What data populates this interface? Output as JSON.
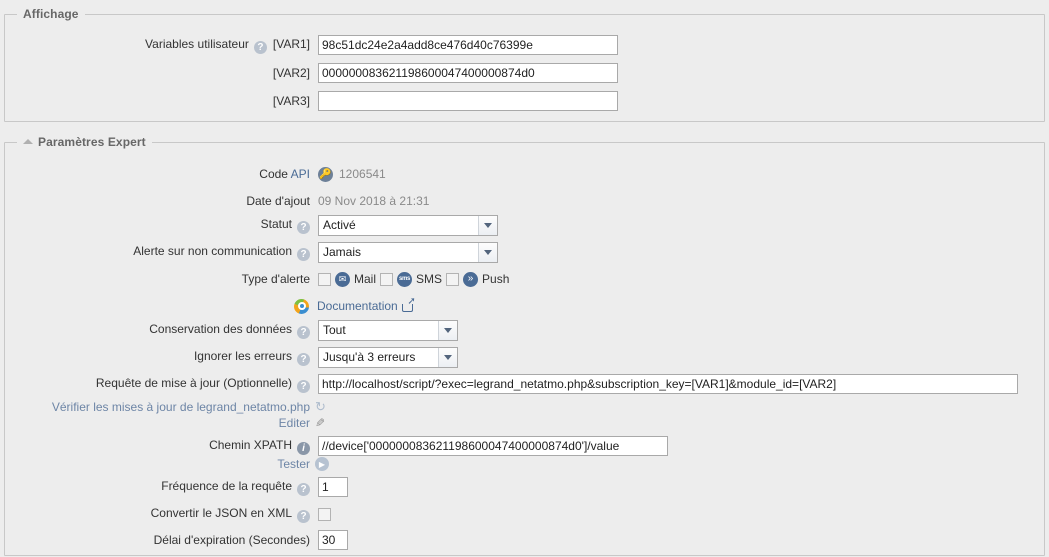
{
  "display_section": {
    "legend": "Affichage",
    "user_vars_label": "Variables utilisateur",
    "rows": [
      {
        "tag": "[VAR1]",
        "value": "98c51dc24e2a4add8ce476d40c76399e"
      },
      {
        "tag": "[VAR2]",
        "value": "000000083621198600047400000874d0"
      },
      {
        "tag": "[VAR3]",
        "value": ""
      }
    ]
  },
  "expert_section": {
    "legend": "Paramètres Expert",
    "api_code": {
      "label_prefix": "Code ",
      "label_link": "API",
      "icon": "key-icon",
      "value": "1206541"
    },
    "date_added": {
      "label": "Date d'ajout",
      "value": "09 Nov 2018 à 21:31"
    },
    "status": {
      "label": "Statut",
      "value": "Activé"
    },
    "no_comm_alert": {
      "label": "Alerte sur non communication",
      "value": "Jamais"
    },
    "alert_type": {
      "label": "Type d'alerte",
      "options": [
        {
          "name": "mail",
          "label": "Mail",
          "icon": "envelope-icon",
          "icon_glyph": "✉",
          "checked": false
        },
        {
          "name": "sms",
          "label": "SMS",
          "icon": "sms-icon",
          "icon_glyph": "sms",
          "checked": false
        },
        {
          "name": "push",
          "label": "Push",
          "icon": "push-icon",
          "icon_glyph": "»",
          "checked": false
        }
      ]
    },
    "documentation": {
      "icon": "globe-icon",
      "label": "Documentation",
      "external_icon": "external-link-icon"
    },
    "data_retention": {
      "label": "Conservation des données",
      "value": "Tout"
    },
    "ignore_errors": {
      "label": "Ignorer les erreurs",
      "value": "Jusqu'à 3 erreurs"
    },
    "update_request": {
      "label": "Requête de mise à jour (Optionnelle)",
      "value": "http://localhost/script/?exec=legrand_netatmo.php&subscription_key=[VAR1]&module_id=[VAR2]"
    },
    "check_updates": {
      "label": "Vérifier les mises à jour de legrand_netatmo.php",
      "icon": "refresh-icon",
      "icon_glyph": "↻"
    },
    "edit": {
      "label": "Editer",
      "icon": "pencil-icon",
      "icon_glyph": "✎"
    },
    "xpath": {
      "label": "Chemin XPATH",
      "value": "//device['000000083621198600047400000874d0']/value"
    },
    "test": {
      "label": "Tester",
      "icon": "play-icon",
      "icon_glyph": "▶"
    },
    "frequency": {
      "label": "Fréquence de la requête",
      "value": "1"
    },
    "json_to_xml": {
      "label": "Convertir le JSON en XML",
      "checked": false
    },
    "timeout": {
      "label": "Délai d'expiration (Secondes)",
      "value": "30"
    }
  },
  "icons": {
    "help": "?",
    "info": "i"
  }
}
